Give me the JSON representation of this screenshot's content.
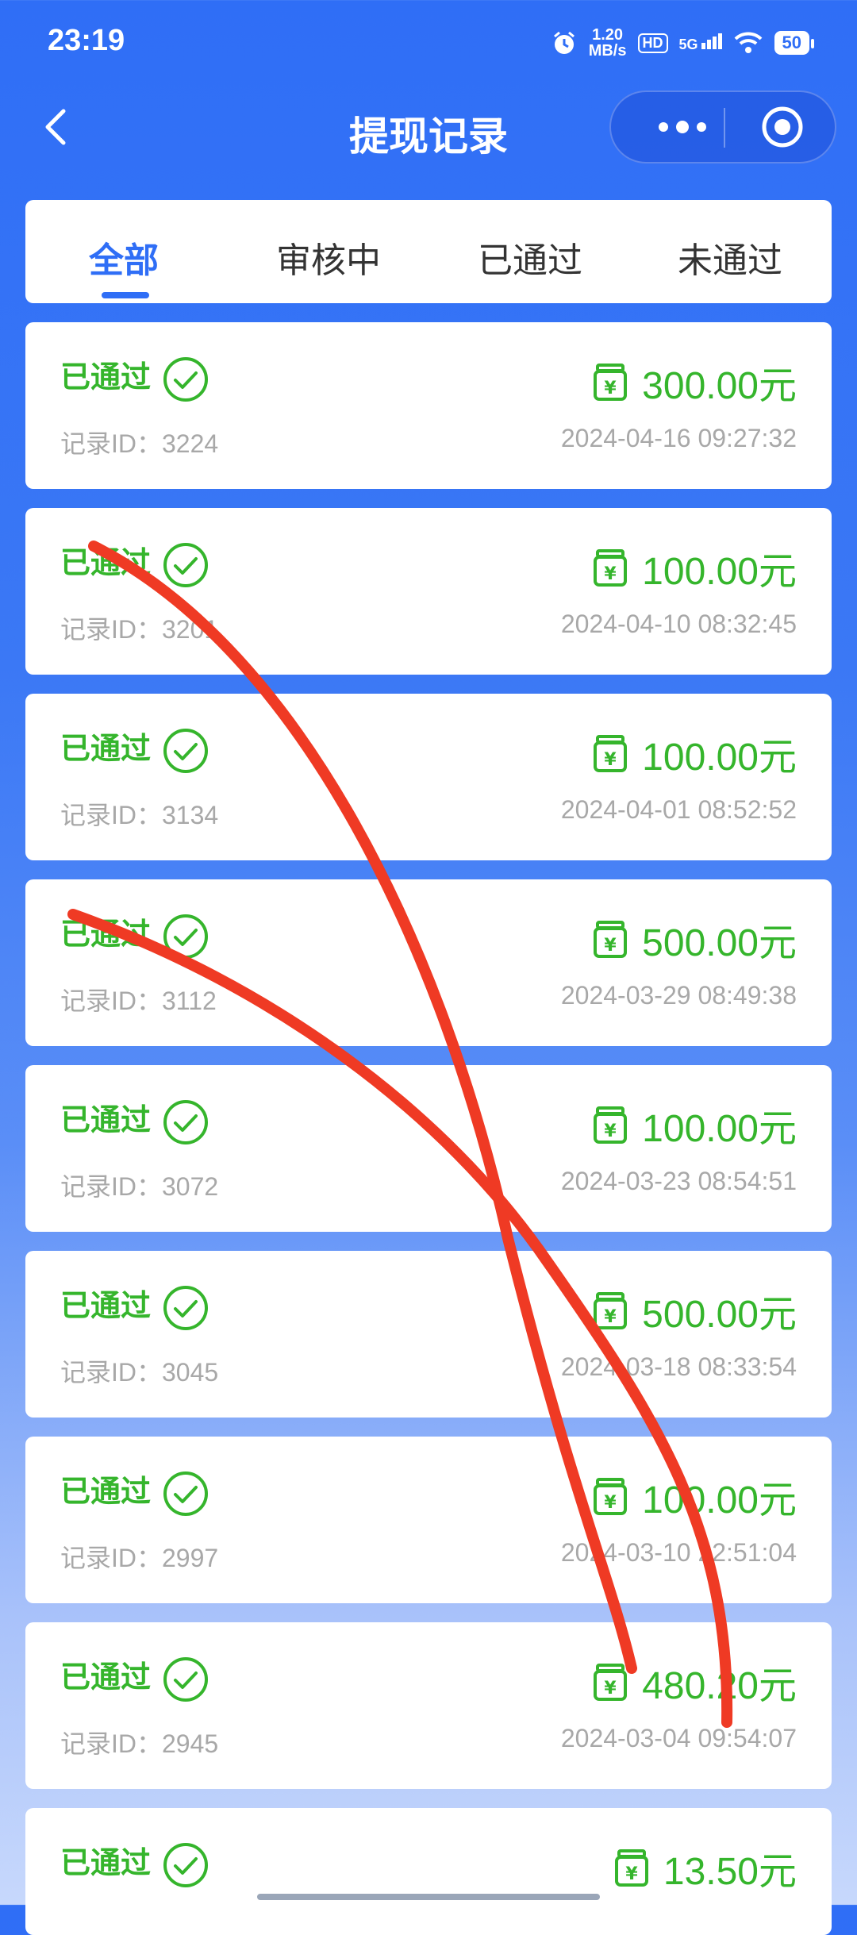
{
  "status_bar": {
    "time": "23:19",
    "speed_value": "1.20",
    "speed_unit": "MB/s",
    "hd": "HD",
    "network": "5G",
    "battery": "50"
  },
  "nav": {
    "title": "提现记录"
  },
  "tabs": [
    {
      "label": "全部",
      "active": true
    },
    {
      "label": "审核中",
      "active": false
    },
    {
      "label": "已通过",
      "active": false
    },
    {
      "label": "未通过",
      "active": false
    }
  ],
  "records": [
    {
      "status": "已通过",
      "amount": "300.00元",
      "id_label": "记录ID：3224",
      "time": "2024-04-16 09:27:32"
    },
    {
      "status": "已通过",
      "amount": "100.00元",
      "id_label": "记录ID：3201",
      "time": "2024-04-10 08:32:45"
    },
    {
      "status": "已通过",
      "amount": "100.00元",
      "id_label": "记录ID：3134",
      "time": "2024-04-01 08:52:52"
    },
    {
      "status": "已通过",
      "amount": "500.00元",
      "id_label": "记录ID：3112",
      "time": "2024-03-29 08:49:38"
    },
    {
      "status": "已通过",
      "amount": "100.00元",
      "id_label": "记录ID：3072",
      "time": "2024-03-23 08:54:51"
    },
    {
      "status": "已通过",
      "amount": "500.00元",
      "id_label": "记录ID：3045",
      "time": "2024-03-18 08:33:54"
    },
    {
      "status": "已通过",
      "amount": "100.00元",
      "id_label": "记录ID：2997",
      "time": "2024-03-10 22:51:04"
    },
    {
      "status": "已通过",
      "amount": "480.20元",
      "id_label": "记录ID：2945",
      "time": "2024-03-04 09:54:07"
    },
    {
      "status": "已通过",
      "amount": "13.50元",
      "id_label": "",
      "time": ""
    }
  ],
  "colors": {
    "primary": "#2f6ef6",
    "success": "#35b52c",
    "muted": "#a8a8a8",
    "scribble": "#ef3a24"
  }
}
